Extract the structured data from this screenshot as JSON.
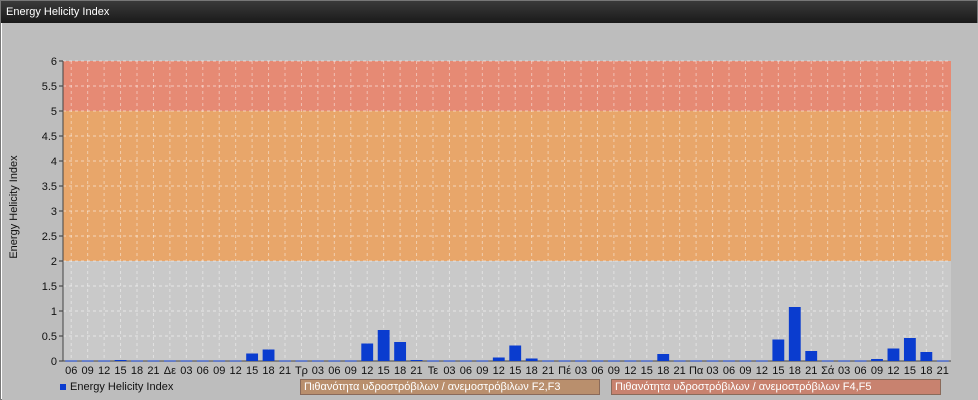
{
  "window": {
    "title": "Energy Helicity Index"
  },
  "legend": {
    "series_label": "Energy Helicity Index",
    "band1_label": "Πιθανότητα υδροστρόβιλων / ανεμοστρόβιλων F2,F3",
    "band2_label": "Πιθανότητα υδροστρόβιλων / ανεμοστρόβιλων F4,F5"
  },
  "colors": {
    "bar": "#0a3ccf",
    "band_low": "#c9c9c9",
    "band_mid": "#e8a66a",
    "band_high": "#e68a74",
    "band1_legend": "#b98f6d",
    "band2_legend": "#c8826f"
  },
  "chart_data": {
    "type": "bar",
    "ylabel": "Energy Helicity Index",
    "xlabel": "",
    "ylim": [
      0,
      6
    ],
    "yticks": [
      "0",
      "0.5",
      "1",
      "1.5",
      "2",
      "2.5",
      "3",
      "3.5",
      "4",
      "4.5",
      "5",
      "5.5",
      "6"
    ],
    "bands": [
      {
        "from": 0,
        "to": 2,
        "name": ""
      },
      {
        "from": 2,
        "to": 5,
        "name": "Πιθανότητα υδροστρόβιλων / ανεμοστρόβιλων F2,F3"
      },
      {
        "from": 5,
        "to": 6,
        "name": "Πιθανότητα υδροστρόβιλων / ανεμοστρόβιλων F4,F5"
      }
    ],
    "grid": true,
    "categories": [
      "06",
      "09",
      "12",
      "15",
      "18",
      "21",
      "Δε",
      "03",
      "06",
      "09",
      "12",
      "15",
      "18",
      "21",
      "Τρ",
      "03",
      "06",
      "09",
      "12",
      "15",
      "18",
      "21",
      "Τε",
      "03",
      "06",
      "09",
      "12",
      "15",
      "18",
      "21",
      "Πέ",
      "03",
      "06",
      "09",
      "12",
      "15",
      "18",
      "21",
      "Πα",
      "03",
      "06",
      "09",
      "12",
      "15",
      "18",
      "21",
      "Σά",
      "03",
      "06",
      "09",
      "12",
      "15",
      "18",
      "21"
    ],
    "series": [
      {
        "name": "Energy Helicity Index",
        "values": [
          0.01,
          0.01,
          0.01,
          0.02,
          0.01,
          0.01,
          0.01,
          0.01,
          0.01,
          0.01,
          0.01,
          0.15,
          0.23,
          0.01,
          0.01,
          0.01,
          0.01,
          0.01,
          0.35,
          0.62,
          0.38,
          0.02,
          0.01,
          0.01,
          0.01,
          0.01,
          0.07,
          0.31,
          0.05,
          0.01,
          0.01,
          0.01,
          0.01,
          0.01,
          0.01,
          0.01,
          0.14,
          0.01,
          0.01,
          0.01,
          0.01,
          0.01,
          0.01,
          0.43,
          1.08,
          0.2,
          0.01,
          0.01,
          0.01,
          0.04,
          0.25,
          0.46,
          0.18,
          0.01
        ]
      }
    ]
  }
}
